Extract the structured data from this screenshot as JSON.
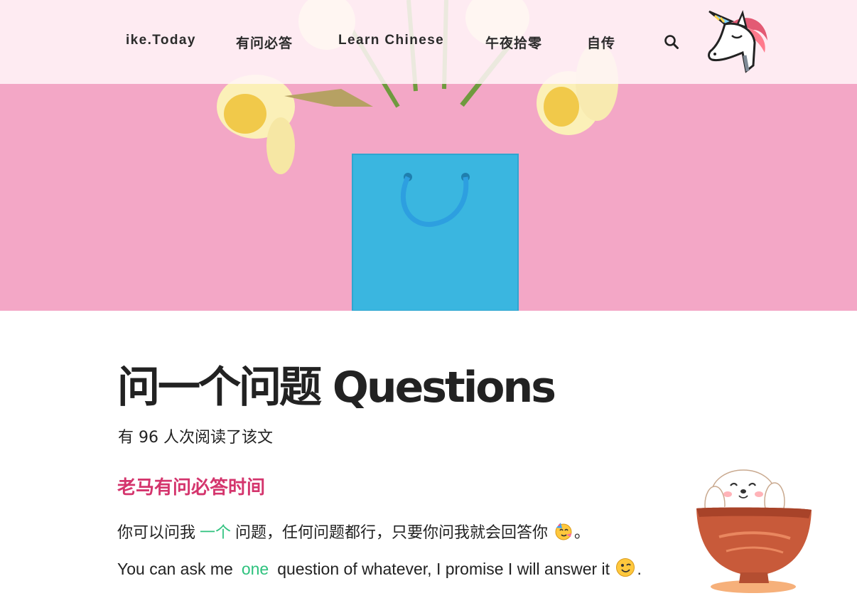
{
  "nav": {
    "items": [
      {
        "label": "ike.Today"
      },
      {
        "label": "有问必答"
      },
      {
        "label": "Learn Chinese"
      },
      {
        "label": "午夜拾零"
      },
      {
        "label": "自传"
      }
    ],
    "search_icon": "search-icon",
    "logo_icon": "unicorn-logo-icon"
  },
  "hero": {
    "image": "pink background with daffodils and blue paper shopping bag"
  },
  "article": {
    "title": "问一个问题 Questions",
    "views": "有 96 人次阅读了该文",
    "section_heading": "老马有问必答时间",
    "zh": {
      "before": "你可以问我",
      "accent": "一个",
      "after": "问题，任何问题都行，只要你问我就会回答你",
      "emoji": "partying-face-emoji",
      "end": "。"
    },
    "en": {
      "before": "You can ask me",
      "accent": "one",
      "after": "question of whatever, I promise I will answer it",
      "emoji": "winking-face-emoji",
      "end": "."
    },
    "mascot": "puppy-in-bowl-illustration"
  },
  "colors": {
    "hero_pink": "#f3a7c6",
    "bag_blue": "#3ab6e0",
    "heading_pink": "#d4356d",
    "accent_green": "#2ec27e",
    "text": "#222222"
  }
}
